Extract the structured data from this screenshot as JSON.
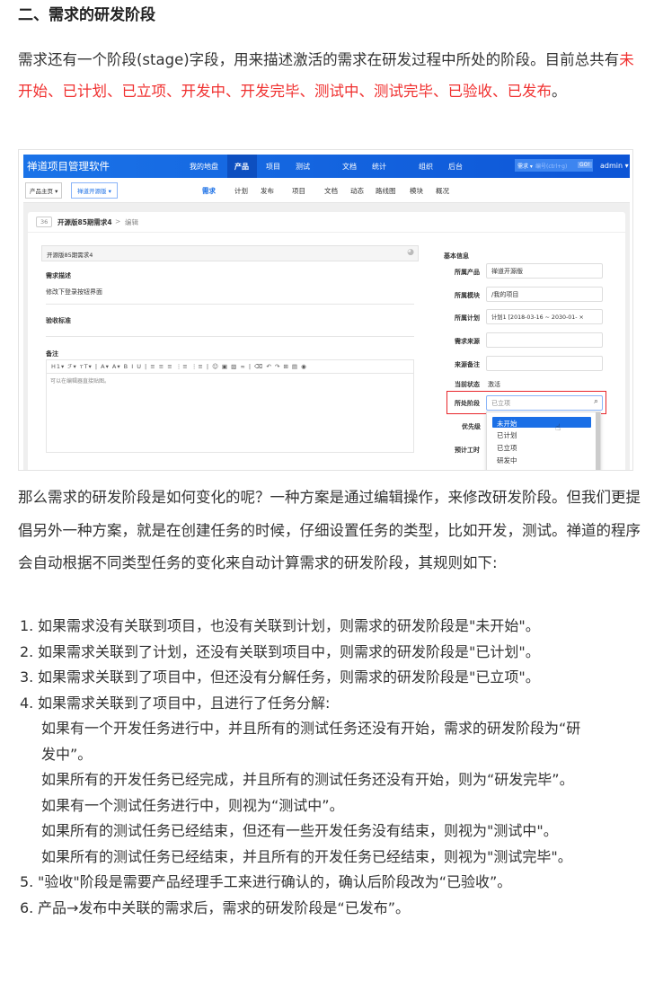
{
  "heading": "二、需求的研发阶段",
  "intro": {
    "part1": "需求还有一个阶段(stage)字段，用来描述激活的需求在研发过程中所处的阶段。目前总共有",
    "stages": "未开始、已计划、已立项、开发中、开发完毕、测试中、测试完毕、已验收、已发布",
    "end": "。"
  },
  "screenshot": {
    "app_title": "禅道项目管理软件",
    "nav": [
      "我的地盘",
      "产品",
      "项目",
      "测试",
      "文档",
      "统计",
      "组织",
      "后台"
    ],
    "search_type": "需求 ▾",
    "search_placeholder": "编号(ctrl+g)",
    "go": "GO!",
    "user": "admin ▾",
    "crumb1": "产品主页 ▾",
    "crumb2": "禅道开源版 ▾",
    "subnav": [
      "需求",
      "计划",
      "发布",
      "项目",
      "文档",
      "动态",
      "路线图",
      "模块",
      "概况"
    ],
    "story_id": "36",
    "story_title": "开源版85期需求4",
    "edit": "编辑",
    "title_field": "开源版85期需求4",
    "desc_label": "需求描述",
    "desc_value": "修改下登录按钮界面",
    "verify_label": "验收标准",
    "comment_label": "备注",
    "editor_toolbar": "H1▾  ℱ▾  ᴛT▾ | A▾  A▾  B  I  U | ≡ ≡ ≡ ⋮≡ ⋮≡ | ☺ ▣ ▨ ∞ | ⌫ ↶ ↷ ⊞ ▤ ◉",
    "editor_placeholder": "可以在编辑器直接贴图。",
    "basic_info": "基本信息",
    "fields": [
      {
        "label": "所属产品",
        "value": "禅道开源版"
      },
      {
        "label": "所属模块",
        "value": "/我的项目"
      },
      {
        "label": "所属计划",
        "value": "计划1 [2018-03-16 ~ 2030-01-  ×"
      },
      {
        "label": "需求来源",
        "value": ""
      },
      {
        "label": "来源备注",
        "value": ""
      }
    ],
    "status_label": "当前状态",
    "status_value": "激活",
    "stage_label": "所处阶段",
    "stage_value": "已立项",
    "priority_label": "优先级",
    "estimate_label": "预计工时",
    "stage_options": [
      "未开始",
      "已计划",
      "已立项",
      "研发中"
    ],
    "colors": {
      "brand": "#1a6fe6",
      "highlight": "#e8262b"
    }
  },
  "para2": "那么需求的研发阶段是如何变化的呢？一种方案是通过编辑操作，来修改研发阶段。但我们更提倡另外一种方案，就是在创建任务的时候，仔细设置任务的类型，比如开发，测试。禅道的程序会自动根据不同类型任务的变化来自动计算需求的研发阶段，其规则如下:",
  "rules": [
    {
      "n": "1.",
      "text": "如果需求没有关联到项目，也没有关联到计划，则需求的研发阶段是\"未开始\"。"
    },
    {
      "n": "2.",
      "text": "如果需求关联到了计划，还没有关联到项目中，则需求的研发阶段是\"已计划\"。"
    },
    {
      "n": "3.",
      "text": "如果需求关联到了项目中，但还没有分解任务，则需求的研发阶段是\"已立项\"。"
    },
    {
      "n": "4.",
      "text": "如果需求关联到了项目中，且进行了任务分解:",
      "sub": [
        "如果有一个开发任务进行中，并且所有的测试任务还没有开始，需求的研发阶段为“研发中”。",
        "如果所有的开发任务已经完成，并且所有的测试任务还没有开始，则为“研发完毕”。",
        "如果有一个测试任务进行中，则视为“测试中”。",
        "如果所有的测试任务已经结束，但还有一些开发任务没有结束，则视为\"测试中\"。",
        "如果所有的测试任务已经结束，并且所有的开发任务已经结束，则视为\"测试完毕\"。"
      ]
    },
    {
      "n": "5.",
      "text": "\"验收\"阶段是需要产品经理手工来进行确认的，确认后阶段改为“已验收”。"
    },
    {
      "n": "6.",
      "text": "产品→发布中关联的需求后，需求的研发阶段是“已发布”。"
    }
  ],
  "colors": {
    "accent": "#f0302f"
  }
}
